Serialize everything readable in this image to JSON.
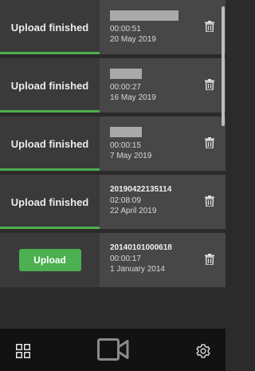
{
  "recordings": [
    {
      "status": "Upload finished",
      "title": "",
      "title_redacted": true,
      "duration": "00:00:51",
      "date": "20 May 2019",
      "uploaded": true
    },
    {
      "status": "Upload finished",
      "title": "",
      "title_redacted": true,
      "duration": "00:00:27",
      "date": "16 May 2019",
      "uploaded": true
    },
    {
      "status": "Upload finished",
      "title": "",
      "title_redacted": true,
      "duration": "00:00:15",
      "date": "7 May 2019",
      "uploaded": true
    },
    {
      "status": "Upload finished",
      "title": "20190422135114",
      "title_redacted": false,
      "duration": "02:08:09",
      "date": "22 April 2019",
      "uploaded": true
    },
    {
      "status": "Upload",
      "title": "20140101000618",
      "title_redacted": false,
      "duration": "00:00:17",
      "date": "1 January 2014",
      "uploaded": false
    }
  ],
  "icons": {
    "delete": "trash-icon",
    "nav_left": "grid-icon",
    "nav_center": "video-camera-icon",
    "nav_right": "gear-icon"
  },
  "colors": {
    "accent": "#4caf50",
    "background": "#2b2b2b",
    "nav_background": "#121212"
  }
}
